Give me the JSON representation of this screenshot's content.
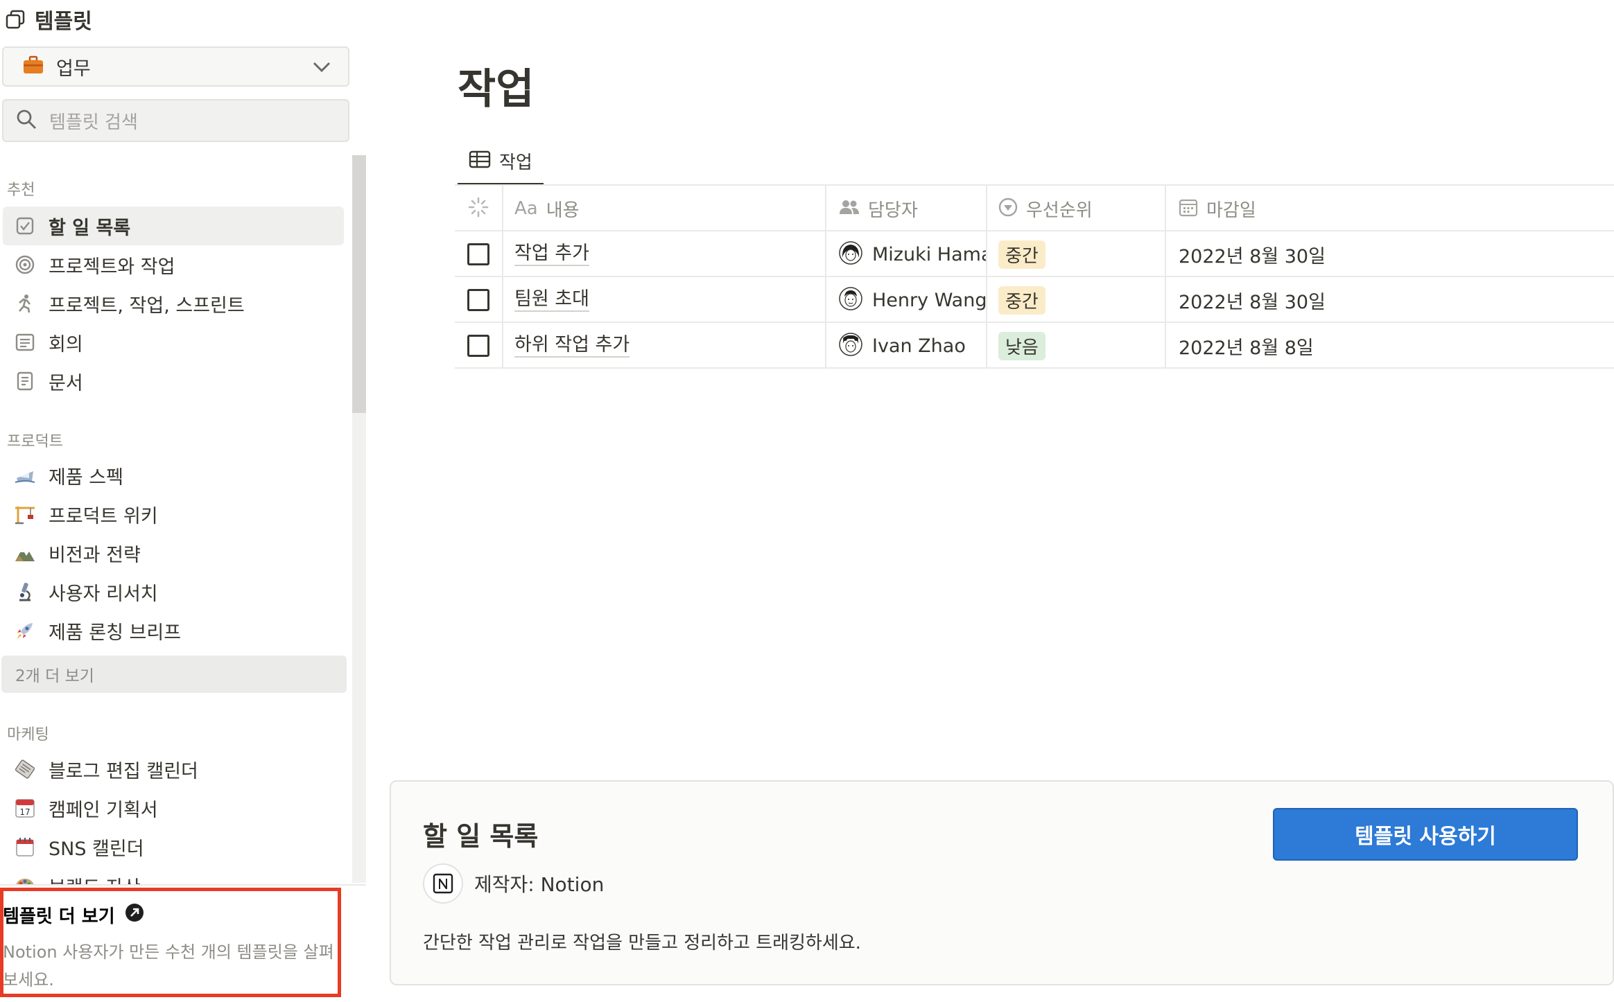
{
  "sidebar": {
    "title": "템플릿",
    "category": {
      "label": "업무"
    },
    "search": {
      "placeholder": "템플릿 검색"
    },
    "sections": {
      "recommended": {
        "label": "추천",
        "items": [
          {
            "label": "할 일 목록",
            "icon": "checkbox-icon",
            "active": true
          },
          {
            "label": "프로젝트와 작업",
            "icon": "target-icon"
          },
          {
            "label": "프로젝트, 작업, 스프린트",
            "icon": "runner-icon"
          },
          {
            "label": "회의",
            "icon": "notes-icon"
          },
          {
            "label": "문서",
            "icon": "document-icon"
          }
        ]
      },
      "product": {
        "label": "프로덕트",
        "items": [
          {
            "label": "제품 스펙",
            "icon": "ship-icon"
          },
          {
            "label": "프로덕트 위키",
            "icon": "crane-icon"
          },
          {
            "label": "비전과 전략",
            "icon": "mountain-icon"
          },
          {
            "label": "사용자 리서치",
            "icon": "microscope-icon"
          },
          {
            "label": "제품 론칭 브리프",
            "icon": "rocket-icon"
          }
        ],
        "more_label": "2개 더 보기"
      },
      "marketing": {
        "label": "마케팅",
        "items": [
          {
            "label": "블로그 편집 캘린더",
            "icon": "newspaper-icon"
          },
          {
            "label": "캠페인 기획서",
            "icon": "calendar-17-icon"
          },
          {
            "label": "SNS 캘린더",
            "icon": "spiral-calendar-icon"
          },
          {
            "label": "브랜드 자산",
            "icon": "palette-icon"
          }
        ]
      }
    },
    "footer": {
      "title": "템플릿 더 보기",
      "description": "Notion 사용자가 만든 수천 개의 템플릿을 살펴보세요."
    }
  },
  "main": {
    "page_title": "작업",
    "view_tab": "작업",
    "table": {
      "headers": [
        {
          "label": "",
          "icon": "loading-icon"
        },
        {
          "label": "내용",
          "prefix": "Aa",
          "icon": "text-icon"
        },
        {
          "label": "담당자",
          "icon": "people-icon"
        },
        {
          "label": "우선순위",
          "icon": "select-icon"
        },
        {
          "label": "마감일",
          "icon": "calendar-icon"
        }
      ],
      "rows": [
        {
          "name": "작업 추가",
          "assignee": "Mizuki Hamada",
          "priority": "중간",
          "priority_color": "#fbecc9",
          "due": "2022년 8월 30일"
        },
        {
          "name": "팀원 초대",
          "assignee": "Henry Wang",
          "priority": "중간",
          "priority_color": "#fbecc9",
          "due": "2022년 8월 30일"
        },
        {
          "name": "하위 작업 추가",
          "assignee": "Ivan Zhao",
          "priority": "낮음",
          "priority_color": "#dbeddb",
          "due": "2022년 8월 8일"
        }
      ]
    }
  },
  "preview_card": {
    "title": "할 일 목록",
    "author": "제작자: Notion",
    "description": "간단한 작업 관리로 작업을 만들고 정리하고 트래킹하세요.",
    "use_button": "템플릿 사용하기"
  },
  "colors": {
    "accent": "#2d7ad7",
    "highlight_box": "#e63b24"
  }
}
